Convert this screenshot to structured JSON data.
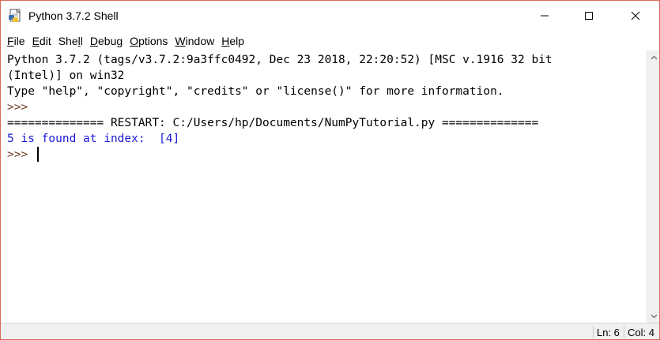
{
  "window": {
    "title": "Python 3.7.2 Shell",
    "border_color": "#d9695a"
  },
  "menu": {
    "items": [
      {
        "accel": "F",
        "rest": "ile"
      },
      {
        "accel": "E",
        "rest": "dit"
      },
      {
        "pre": "She",
        "accel": "l",
        "rest": "l"
      },
      {
        "accel": "D",
        "rest": "ebug"
      },
      {
        "accel": "O",
        "rest": "ptions"
      },
      {
        "accel": "W",
        "rest": "indow"
      },
      {
        "accel": "H",
        "rest": "elp"
      }
    ]
  },
  "shell": {
    "lines": [
      "Python 3.7.2 (tags/v3.7.2:9a3ffc0492, Dec 23 2018, 22:20:52) [MSC v.1916 32 bit",
      "(Intel)] on win32",
      "Type \"help\", \"copyright\", \"credits\" or \"license()\" for more information.",
      ">>> ",
      "============== RESTART: C:/Users/hp/Documents/NumPyTutorial.py ==============",
      "5 is found at index:  [4]",
      ">>> "
    ],
    "output_color": "#1a1ad6",
    "prompt_color": "#6b3a1f"
  },
  "status": {
    "ln": "Ln: 6",
    "col": "Col: 4"
  },
  "icons": {
    "app": "python-idle-icon",
    "minimize": "minimize-icon",
    "maximize": "maximize-icon",
    "close": "close-icon",
    "scroll_up": "chevron-up-icon",
    "scroll_down": "chevron-down-icon"
  }
}
